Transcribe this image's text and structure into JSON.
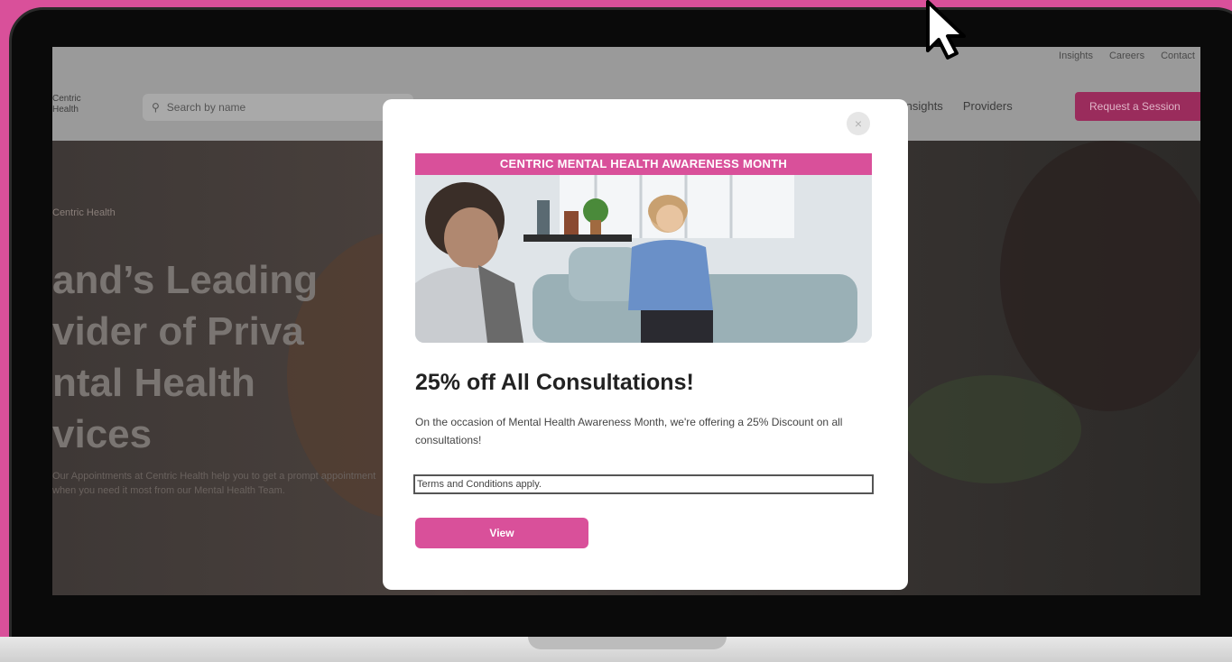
{
  "header": {
    "utility_links": [
      "Insights",
      "Careers",
      "Contact"
    ],
    "logo_text": "Centric\nHealth",
    "search_placeholder": "Search by name",
    "nav_links": [
      "Insights",
      "Providers"
    ],
    "cta_label": "Request a Session"
  },
  "hero": {
    "eyebrow": "Centric Health",
    "title": "and’s Leading\nvider of Priva\nntal Health\nvices",
    "body": "Our Appointments at Centric Health help you to get a prompt appointment when you need it most from our Mental Health Team."
  },
  "modal": {
    "close_icon": "×",
    "banner": "CENTRIC MENTAL HEALTH AWARENESS MONTH",
    "headline": "25% off All Consultations!",
    "description": "On the occasion of Mental Health Awareness Month, we're offering a 25% Discount on all consultations!",
    "terms": "Terms and Conditions apply.",
    "button_label": "View"
  },
  "colors": {
    "brand_pink": "#d9509a",
    "frame": "#0a0a0a"
  }
}
